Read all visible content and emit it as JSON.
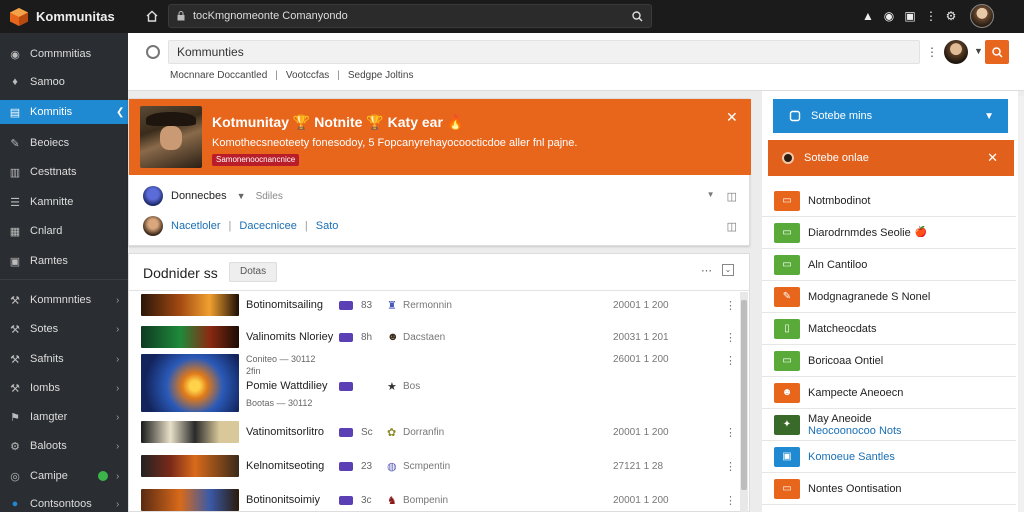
{
  "topbar": {
    "brand": "Kommunitas",
    "url": "tocKmgnomeonte Comanyondo",
    "icons": [
      "logo-cube-icon",
      "home-icon",
      "lock-icon",
      "bell-icon",
      "shield-icon",
      "clipboard-icon",
      "more-icon",
      "settings-icon"
    ]
  },
  "sidebar": {
    "items": [
      {
        "label": "Commmitias",
        "icon": "community-icon",
        "chevron": false
      },
      {
        "label": "Samoo",
        "icon": "compass-icon",
        "chevron": false
      },
      {
        "label": "Komnitis",
        "icon": "grid-icon",
        "chevron": true,
        "active": true
      },
      {
        "label": "Beoiecs",
        "icon": "pin-icon",
        "chevron": false
      },
      {
        "label": "Cesttnats",
        "icon": "book-icon",
        "chevron": false
      },
      {
        "label": "Kamnitte",
        "icon": "list-icon",
        "chevron": false
      },
      {
        "label": "Cnlard",
        "icon": "calendar-icon",
        "chevron": false
      },
      {
        "label": "Ramtes",
        "icon": "table-icon",
        "chevron": false
      },
      {
        "label": "Kommnnties",
        "icon": "wrench-icon",
        "chevron": true
      },
      {
        "label": "Sotes",
        "icon": "wrench-icon",
        "chevron": true
      },
      {
        "label": "Safnits",
        "icon": "wrench-icon",
        "chevron": true
      },
      {
        "label": "Iombs",
        "icon": "wrench-icon",
        "chevron": true
      },
      {
        "label": "Iamgter",
        "icon": "flag-icon",
        "chevron": true
      },
      {
        "label": "Baloots",
        "icon": "gear-icon",
        "chevron": true
      },
      {
        "label": "Camipe",
        "icon": "globe-icon",
        "chevron": true,
        "status_dot": true
      },
      {
        "label": "Contsontoos",
        "icon": "chat-icon",
        "chevron": true
      }
    ]
  },
  "searchhead": {
    "search_value": "Kommunties",
    "crumbs": [
      "Mocnnare Doccantled",
      "Vootccfas",
      "Sedgpe Joltins"
    ]
  },
  "card": {
    "title": "Kotmunitay 🏆  Notnite 🏆  Katy ear 🔥",
    "subtitle": "Komothecsneoteety fonesodoy, 5 Fopcanyrehayocoocticdoe aller fnl pajne.",
    "tag": "Samonenoocnancnice",
    "post1": {
      "name": "Donnecbes",
      "meta": "Sdiles"
    },
    "post2": {
      "links": [
        "Nacetloler",
        "Dacecnicee",
        "Sato"
      ]
    }
  },
  "listpanel": {
    "title": "Dodnider ss",
    "chip": "Dotas",
    "rows": [
      {
        "name": "Botinomitsailing",
        "num": "83",
        "cat": "Rermonnin",
        "date": "20001 1  200",
        "icon": "♜",
        "thumb": "linear-gradient(90deg,#2a1608,#a44a12 40%,#f0a030 70%,#1c0e06)"
      },
      {
        "name": "Valinomits Nloriey",
        "num": "8h",
        "cat": "Dacstaen",
        "date": "20031 1  201",
        "icon": "☻",
        "thumb": "linear-gradient(90deg,#0e3a22,#1f8a3a 40%,#8b2a12 70%,#1a0c04)"
      },
      {
        "name": "Pomie Wattdiliey",
        "num": "",
        "cat": "Bos",
        "date": "26001 1  200",
        "icon": "★",
        "thumb": "radial-gradient(circle at 55% 55%,#ffd24a 8%,#e07a1a 20%,#2a5ab8 45%,#13245c 80%)",
        "sub1": "Coniteo — 30112",
        "sub2": "2fin",
        "sub3": "Bootas — 30112"
      },
      {
        "name": "Vatinomitsorlitro",
        "num": "Sc",
        "cat": "Dorranfin",
        "date": "20001 1  200",
        "icon": "✿",
        "thumb": "linear-gradient(90deg,#1a1a1a,#e8e0c8 30%,#2a2a2a 55%,#d8c89a 80%)"
      },
      {
        "name": "Kelnomitseoting",
        "num": "23",
        "cat": "Scmpentin",
        "date": "27121 1  28",
        "icon": "◍",
        "thumb": "linear-gradient(90deg,#222,#7a2a1a 30%,#d86a1a 55%,#3a2a1a)"
      },
      {
        "name": "Botinonitsoimiy",
        "num": "3c",
        "cat": "Bompenin",
        "date": "20001 1  200",
        "icon": "♞",
        "thumb": "linear-gradient(90deg,#5a2a12,#d86a1a 40%,#3a5aa8 70%,#2a1a0a)"
      }
    ]
  },
  "right": {
    "select_label": "Sotebe mins",
    "orange_header": "Sotebe onlae",
    "items": [
      {
        "label": "Notmbodinot",
        "color": "#e8661c",
        "icon": "▭"
      },
      {
        "label": "Diarodrnmdes Seolie",
        "color": "#5aaa3a",
        "icon": "▭",
        "extra": "🍎"
      },
      {
        "label": "Aln Cantiloo",
        "color": "#5aaa3a",
        "icon": "▭"
      },
      {
        "label": "Modgnagranede S Nonel",
        "color": "#e8661c",
        "icon": "✎"
      },
      {
        "label": "Matcheocdats",
        "color": "#5aaa3a",
        "icon": "▯"
      },
      {
        "label": "Boricoaa Ontiel",
        "color": "#5aaa3a",
        "icon": "▭"
      },
      {
        "label": "Kampecte Aneoecn",
        "color": "#e8661c",
        "icon": "☻"
      },
      {
        "label": "May Aneoide",
        "label2": "Neocoonocoo Nots",
        "color": "#3a6a2a",
        "icon": "✦"
      },
      {
        "label": "Komoeue Santles",
        "label_accent": true,
        "color": "#1f8ad1",
        "icon": "▣"
      },
      {
        "label": "Nontes Oontisation",
        "color": "#e8661c",
        "icon": "▭"
      }
    ]
  }
}
